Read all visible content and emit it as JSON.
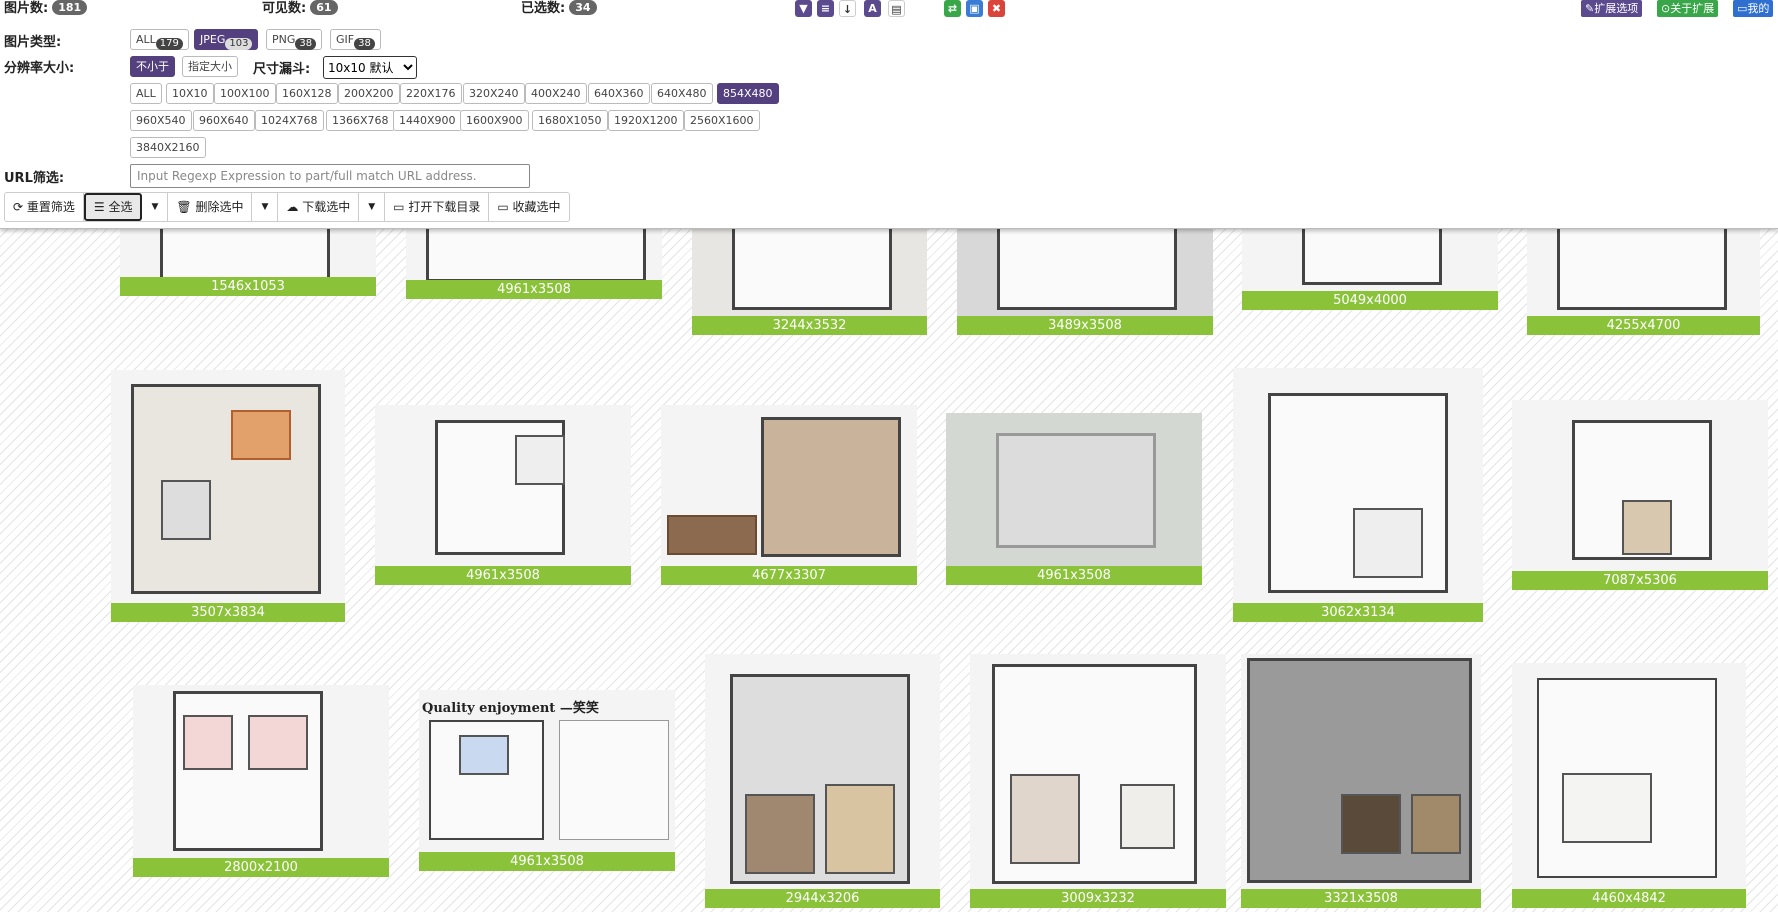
{
  "stats": {
    "total_label": "图片数:",
    "total": "181",
    "visible_label": "可见数:",
    "visible": "61",
    "selected_label": "已选数:",
    "selected": "34"
  },
  "toolbar_icons": [
    "filter-icon",
    "list-icon",
    "sort-icon",
    "font-icon",
    "compare-icon"
  ],
  "tools2": {
    "swap": "⇄",
    "page": "▣",
    "close": "✖"
  },
  "ext_buttons": {
    "options": "扩展选项",
    "about": "关于扩展",
    "mine": "我的"
  },
  "type_filter": {
    "label": "图片类型:",
    "chips": [
      {
        "name": "ALL",
        "count": "179"
      },
      {
        "name": "JPEG",
        "count": "103"
      },
      {
        "name": "PNG",
        "count": "38"
      },
      {
        "name": "GIF",
        "count": "38"
      }
    ],
    "active": "JPEG"
  },
  "size_filter": {
    "label": "分辨率大小:",
    "not_less": "不小于",
    "specify": "指定大小",
    "funnel_label": "尺寸漏斗:",
    "funnel_value": "10x10 默认",
    "sizes_row1": [
      "ALL",
      "10X10",
      "100X100",
      "160X128",
      "200X200",
      "220X176",
      "320X240",
      "400X240",
      "640X360",
      "640X480",
      "854X480"
    ],
    "sizes_row2": [
      "960X540",
      "960X640",
      "1024X768",
      "1366X768",
      "1440X900",
      "1600X900",
      "1680X1050",
      "1920X1200",
      "2560X1600"
    ],
    "sizes_row3": [
      "3840X2160"
    ],
    "active": "854X480"
  },
  "url_filter": {
    "label": "URL筛选:",
    "placeholder": "Input Regexp Expression to part/full match URL address."
  },
  "actions": {
    "reset": "重置筛选",
    "select_all": "全选",
    "delete": "删除选中",
    "download": "下载选中",
    "open_dir": "打开下载目录",
    "favorite": "收藏选中"
  },
  "images": [
    {
      "dim": "1546x1053"
    },
    {
      "dim": "4961x3508"
    },
    {
      "dim": "3244x3532"
    },
    {
      "dim": "3489x3508"
    },
    {
      "dim": "5049x4000"
    },
    {
      "dim": "4255x4700"
    },
    {
      "dim": "3507x3834"
    },
    {
      "dim": "4961x3508"
    },
    {
      "dim": "4677x3307"
    },
    {
      "dim": "4961x3508"
    },
    {
      "dim": "3062x3134"
    },
    {
      "dim": "7087x5306"
    },
    {
      "dim": "2800x2100"
    },
    {
      "dim": "4961x3508"
    },
    {
      "dim": "2944x3206"
    },
    {
      "dim": "3009x3232"
    },
    {
      "dim": "3321x3508"
    },
    {
      "dim": "4460x4842"
    }
  ],
  "image_texts": {
    "quality": "Quality enjoyment —笑笑"
  },
  "colors": {
    "accent": "#54407f",
    "dim_bar": "#8ac23a",
    "green": "#3aa64a",
    "red": "#d9453a"
  }
}
